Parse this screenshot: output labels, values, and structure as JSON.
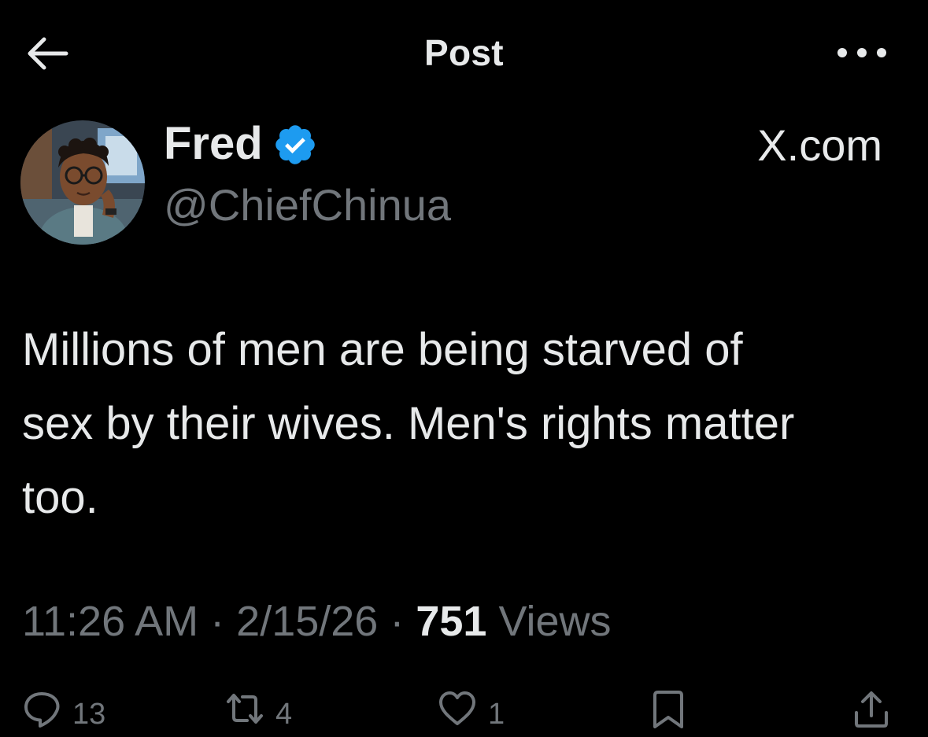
{
  "header": {
    "title": "Post",
    "back_icon": "arrow-left-icon",
    "more_icon": "more-horizontal-icon"
  },
  "author": {
    "display_name": "Fred",
    "handle": "@ChiefChinua",
    "verified": true,
    "verified_icon": "verified-badge-icon",
    "source_label": "X.com"
  },
  "post": {
    "text": "Millions of men are being starved of\nsex by their wives. Men's rights matter\ntoo."
  },
  "meta": {
    "time": "11:26 AM",
    "separator": " · ",
    "date": "2/15/26",
    "views_count": "751",
    "views_label": " Views"
  },
  "actions": {
    "reply_count": "13",
    "repost_count": "4",
    "like_count": "1",
    "reply_icon": "reply-bubble-icon",
    "repost_icon": "repost-icon",
    "like_icon": "heart-icon",
    "bookmark_icon": "bookmark-icon",
    "share_icon": "share-icon"
  },
  "colors": {
    "background": "#000000",
    "text_primary": "#e7e9ea",
    "text_secondary": "#71767b",
    "verified_blue": "#1d9bf0"
  }
}
